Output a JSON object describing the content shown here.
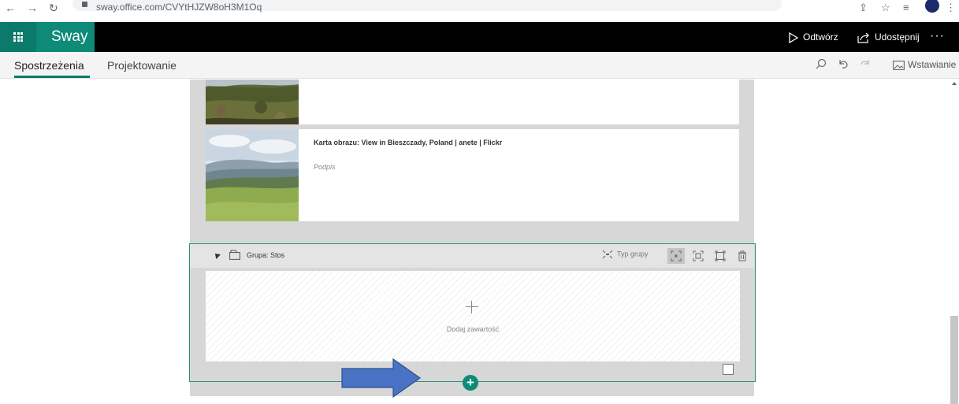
{
  "browser": {
    "back": "←",
    "forward": "→",
    "reload": "↻",
    "url": "sway.office.com/CVYtHJZW8oH3M1Oq"
  },
  "app": {
    "brand": "Sway",
    "play_label": "Odtwórz",
    "share_label": "Udostępnij",
    "more_label": "···"
  },
  "tabs": [
    {
      "label": "Spostrzeżenia",
      "active": true
    },
    {
      "label": "Projektowanie",
      "active": false
    }
  ],
  "toolbar": {
    "insert_label": "Wstawianie",
    "icons": [
      "search-icon",
      "undo-icon",
      "redo-icon",
      "insert-image-icon"
    ]
  },
  "cards": [
    {
      "caption_title": "",
      "caption_sub": ""
    },
    {
      "caption_title": "Karta obrazu: View in Bieszczady, Poland | anete | Flickr",
      "caption_sub": "Podpis"
    }
  ],
  "group": {
    "title": "Grupa: Stos",
    "type_label": "Typ grupy",
    "add_content_label": "Dodaj zawartość",
    "add_button": "+"
  },
  "colors": {
    "accent": "#0e8a78",
    "app_bar": "#000000",
    "arrow": "#4a72c4"
  }
}
